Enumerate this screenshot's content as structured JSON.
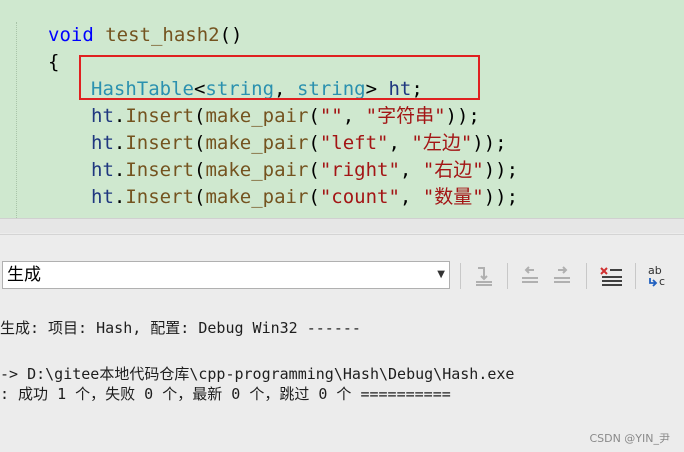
{
  "editor": {
    "lines": [
      {
        "segments": [
          {
            "cls": "kw",
            "text": "void"
          },
          {
            "cls": "plain",
            "text": " "
          },
          {
            "cls": "fn",
            "text": "test_hash2"
          },
          {
            "cls": "plain",
            "text": "()"
          }
        ]
      },
      {
        "segments": [
          {
            "cls": "plain",
            "text": "{"
          }
        ]
      },
      {
        "segments": [
          {
            "cls": "type",
            "text": "HashTable"
          },
          {
            "cls": "plain",
            "text": "<"
          },
          {
            "cls": "type",
            "text": "string"
          },
          {
            "cls": "plain",
            "text": ", "
          },
          {
            "cls": "type",
            "text": "string"
          },
          {
            "cls": "plain",
            "text": "> "
          },
          {
            "cls": "var",
            "text": "ht"
          },
          {
            "cls": "plain",
            "text": ";"
          }
        ]
      },
      {
        "segments": [
          {
            "cls": "var",
            "text": "ht"
          },
          {
            "cls": "plain",
            "text": "."
          },
          {
            "cls": "fn",
            "text": "Insert"
          },
          {
            "cls": "plain",
            "text": "("
          },
          {
            "cls": "fn",
            "text": "make_pair"
          },
          {
            "cls": "plain",
            "text": "("
          },
          {
            "cls": "str",
            "text": "\"\""
          },
          {
            "cls": "plain",
            "text": ", "
          },
          {
            "cls": "str",
            "text": "\"字符串\""
          },
          {
            "cls": "plain",
            "text": "));"
          }
        ]
      },
      {
        "segments": [
          {
            "cls": "var",
            "text": "ht"
          },
          {
            "cls": "plain",
            "text": "."
          },
          {
            "cls": "fn",
            "text": "Insert"
          },
          {
            "cls": "plain",
            "text": "("
          },
          {
            "cls": "fn",
            "text": "make_pair"
          },
          {
            "cls": "plain",
            "text": "("
          },
          {
            "cls": "str",
            "text": "\"left\""
          },
          {
            "cls": "plain",
            "text": ", "
          },
          {
            "cls": "str",
            "text": "\"左边\""
          },
          {
            "cls": "plain",
            "text": "));"
          }
        ]
      },
      {
        "segments": [
          {
            "cls": "var",
            "text": "ht"
          },
          {
            "cls": "plain",
            "text": "."
          },
          {
            "cls": "fn",
            "text": "Insert"
          },
          {
            "cls": "plain",
            "text": "("
          },
          {
            "cls": "fn",
            "text": "make_pair"
          },
          {
            "cls": "plain",
            "text": "("
          },
          {
            "cls": "str",
            "text": "\"right\""
          },
          {
            "cls": "plain",
            "text": ", "
          },
          {
            "cls": "str",
            "text": "\"右边\""
          },
          {
            "cls": "plain",
            "text": "));"
          }
        ]
      },
      {
        "segments": [
          {
            "cls": "var",
            "text": "ht"
          },
          {
            "cls": "plain",
            "text": "."
          },
          {
            "cls": "fn",
            "text": "Insert"
          },
          {
            "cls": "plain",
            "text": "("
          },
          {
            "cls": "fn",
            "text": "make_pair"
          },
          {
            "cls": "plain",
            "text": "("
          },
          {
            "cls": "str",
            "text": "\"count\""
          },
          {
            "cls": "plain",
            "text": ", "
          },
          {
            "cls": "str",
            "text": "\"数量\""
          },
          {
            "cls": "plain",
            "text": "));"
          }
        ]
      }
    ]
  },
  "output": {
    "source_selected": "生成",
    "lines": [
      "生成: 项目: Hash, 配置: Debug Win32 ------",
      "",
      "-> D:\\gitee本地代码仓库\\cpp-programming\\Hash\\Debug\\Hash.exe",
      ": 成功 1 个，失败 0 个，最新 0 个，跳过 0 个 =========="
    ]
  },
  "watermark": "CSDN @YIN_尹",
  "colors": {
    "editor_bg": "#cfe8cf",
    "highlight_border": "#e02020",
    "keyword": "#0000ff",
    "type": "#2b91af",
    "string": "#a31515"
  },
  "icons": {
    "toolbar": [
      "find-previous-message-icon",
      "go-to-previous-message-icon",
      "go-to-next-message-icon",
      "clear-all-icon",
      "toggle-word-wrap-icon"
    ]
  }
}
